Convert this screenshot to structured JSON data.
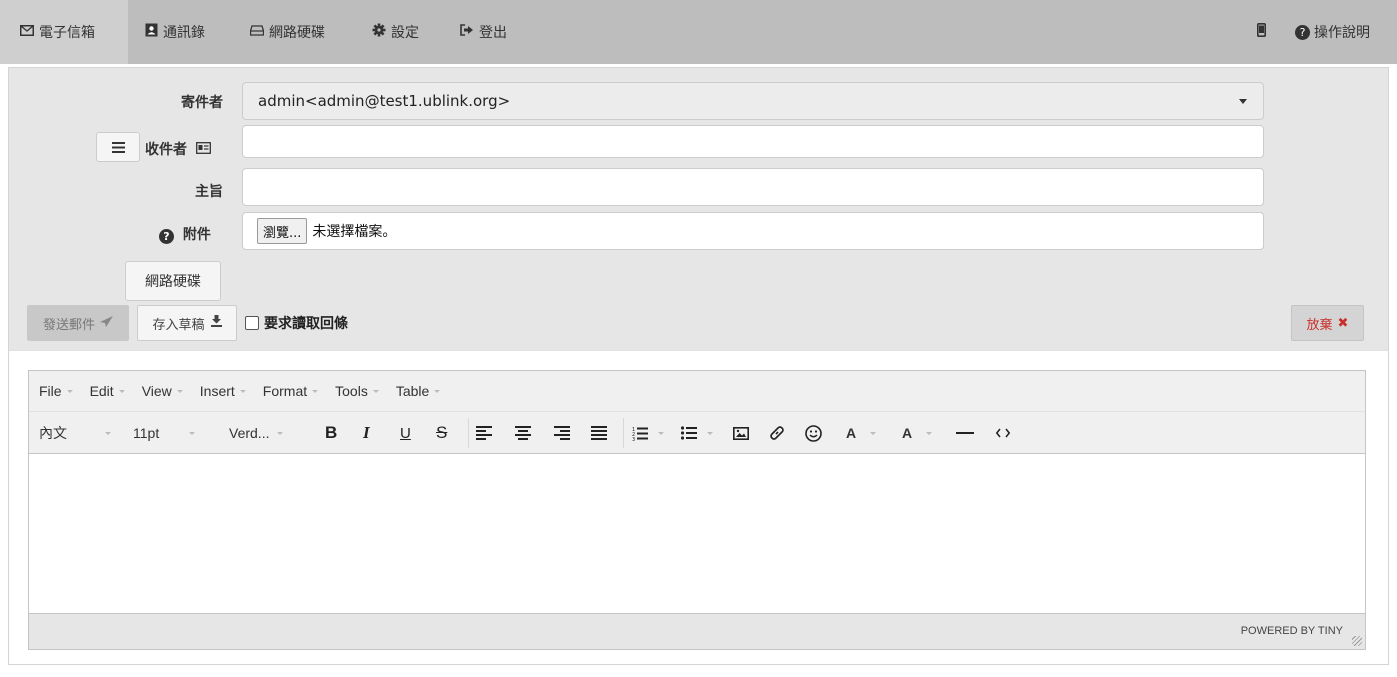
{
  "nav": {
    "email": "電子信箱",
    "contacts": "通訊錄",
    "network_disk": "網路硬碟",
    "settings": "設定",
    "logout": "登出",
    "help": "操作說明"
  },
  "compose": {
    "sender_label": "寄件者",
    "sender_value": "admin<admin@test1.ublink.org>",
    "recipient_label": "收件者",
    "recipient_value": "",
    "subject_label": "主旨",
    "subject_value": "",
    "attachment_label": "附件",
    "browse_label": "瀏覽...",
    "no_file_label": "未選擇檔案。",
    "network_disk_button": "網路硬碟",
    "send_button": "發送郵件",
    "save_draft_button": "存入草稿",
    "read_receipt_label": "要求讀取回條",
    "discard_button": "放棄"
  },
  "editor": {
    "menus": [
      "File",
      "Edit",
      "View",
      "Insert",
      "Format",
      "Tools",
      "Table"
    ],
    "block_format": "內文",
    "font_size": "11pt",
    "font_family": "Verd...",
    "powered_by": "POWERED BY TINY"
  },
  "colors": {
    "nav_bg": "#bdbdbd",
    "panel_bg": "#e6e6e6",
    "discard_red": "#c9302c"
  }
}
